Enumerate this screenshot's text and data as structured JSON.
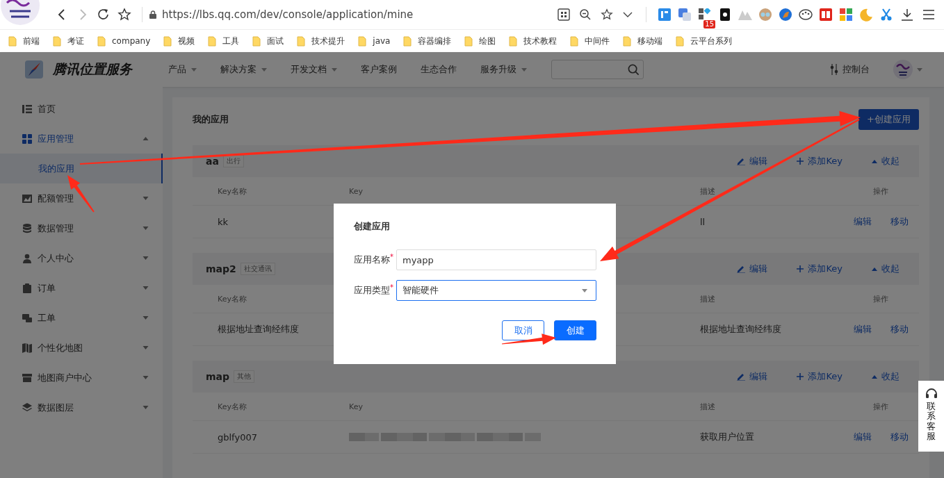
{
  "browser": {
    "url": "https://lbs.qq.com/dev/console/application/mine",
    "extension_badge": "15"
  },
  "bookmarks": [
    "前端",
    "考证",
    "company",
    "视频",
    "工具",
    "面试",
    "技术提升",
    "java",
    "容器编排",
    "绘图",
    "技术教程",
    "中间件",
    "移动端",
    "云平台系列"
  ],
  "header": {
    "brand": "腾讯位置服务",
    "nav": [
      {
        "label": "产品",
        "dropdown": true
      },
      {
        "label": "解决方案",
        "dropdown": true
      },
      {
        "label": "开发文档",
        "dropdown": true
      },
      {
        "label": "客户案例",
        "dropdown": false
      },
      {
        "label": "生态合作",
        "dropdown": false
      },
      {
        "label": "服务升级",
        "dropdown": true
      }
    ],
    "console": "控制台"
  },
  "sidebar": {
    "items": [
      {
        "label": "首页",
        "kind": "link",
        "selected": false
      },
      {
        "label": "应用管理",
        "kind": "menu",
        "selected": true,
        "expanded": true,
        "children": [
          {
            "label": "我的应用",
            "selected": true
          }
        ]
      },
      {
        "label": "配额管理",
        "kind": "menu",
        "selected": false,
        "expanded": false
      },
      {
        "label": "数据管理",
        "kind": "menu",
        "selected": false,
        "expanded": false
      },
      {
        "label": "个人中心",
        "kind": "menu",
        "selected": false,
        "expanded": false
      },
      {
        "label": "订单",
        "kind": "menu",
        "selected": false,
        "expanded": false
      },
      {
        "label": "工单",
        "kind": "menu",
        "selected": false,
        "expanded": false
      },
      {
        "label": "个性化地图",
        "kind": "menu",
        "selected": false,
        "expanded": false
      },
      {
        "label": "地图商户中心",
        "kind": "menu",
        "selected": false,
        "expanded": false
      },
      {
        "label": "数据图层",
        "kind": "menu",
        "selected": false,
        "expanded": false
      }
    ]
  },
  "main": {
    "title": "我的应用",
    "create_button": "+创建应用",
    "groups": [
      {
        "name": "aa",
        "tag": "出行",
        "actions": [
          {
            "label": "编辑",
            "kind": "edit"
          },
          {
            "label": "添加Key",
            "kind": "add"
          },
          {
            "label": "收起",
            "kind": "collapse"
          }
        ],
        "columns": {
          "name": "Key名称",
          "key": "Key",
          "description": "描述",
          "operations": "操作"
        },
        "rows": [
          {
            "name": "kk",
            "description": "ll",
            "actions": [
              "编辑",
              "移动"
            ]
          }
        ]
      },
      {
        "name": "map2",
        "tag": "社交通讯",
        "actions": [
          {
            "label": "编辑",
            "kind": "edit"
          },
          {
            "label": "添加Key",
            "kind": "add"
          },
          {
            "label": "收起",
            "kind": "collapse"
          }
        ],
        "columns": {
          "name": "Key名称",
          "description": "描述",
          "operations": "操作"
        },
        "rows": [
          {
            "name": "根据地址查询经纬度",
            "description": "根据地址查询经纬度",
            "actions": [
              "编辑",
              "移动"
            ]
          }
        ]
      },
      {
        "name": "map",
        "tag": "其他",
        "actions": [
          {
            "label": "编辑",
            "kind": "edit"
          },
          {
            "label": "添加Key",
            "kind": "add"
          },
          {
            "label": "收起",
            "kind": "collapse"
          }
        ],
        "columns": {
          "name": "Key名称",
          "key": "Key",
          "description": "描述",
          "operations": "操作"
        },
        "rows": [
          {
            "name": "gblfy007",
            "key": {
              "kind": "blurred"
            },
            "description": "获取用户位置",
            "actions": [
              "编辑",
              "移动"
            ]
          }
        ]
      }
    ]
  },
  "modal": {
    "title": "创建应用",
    "fields": [
      {
        "label": "应用名称",
        "required_mark": "*",
        "kind": "text",
        "value": "myapp",
        "focused": false
      },
      {
        "label": "应用类型",
        "required_mark": "*",
        "kind": "select",
        "value": "智能硬件",
        "focused": true
      }
    ],
    "buttons": [
      {
        "label": "取消",
        "kind": "secondary"
      },
      {
        "label": "创建",
        "kind": "primary"
      }
    ]
  },
  "contact": {
    "label": "联系客服"
  }
}
